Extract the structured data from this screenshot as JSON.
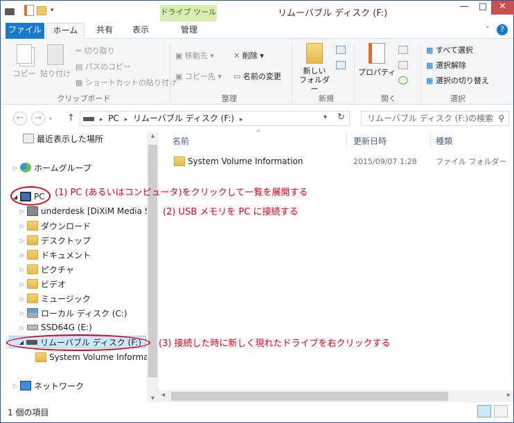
{
  "window": {
    "title": "リムーバブル ディスク (F:)",
    "context_tab": "ドライブ ツール",
    "min_btn": "—",
    "max_btn": "□",
    "close_btn": "✕",
    "help_btn": "?",
    "collapse_btn": "˅"
  },
  "tabs": [
    "ファイル",
    "ホーム",
    "共有",
    "表示",
    "管理"
  ],
  "ribbon": {
    "clipboard": {
      "copy": "コピー",
      "paste": "貼り付け",
      "cut": "切り取り",
      "copy_path": "パスのコピー",
      "paste_shortcut": "ショートカットの貼り付け",
      "group_label": "クリップボード"
    },
    "organize": {
      "move_to": "移動先",
      "copy_to": "コピー先",
      "delete": "削除",
      "rename": "名前の変更",
      "group_label": "整理"
    },
    "new": {
      "new_folder_line1": "新しい",
      "new_folder_line2": "フォルダー",
      "group_label": "新規"
    },
    "open": {
      "properties": "プロパティ",
      "group_label": "開く"
    },
    "select": {
      "select_all": "すべて選択",
      "select_none": "選択解除",
      "invert": "選択の切り替え",
      "group_label": "選択"
    }
  },
  "address": {
    "back": "←",
    "forward": "→",
    "up": "↑",
    "root_sep": "▸",
    "crumb_pc": "PC",
    "crumb_sep": "▸",
    "crumb_drive": "リムーバブル ディスク (F:)",
    "crumb_sep2": "▸",
    "dropdown": "▾",
    "refresh": "↻",
    "search_placeholder": "リムーバブル ディスク (F:)の検索",
    "search_icon": "⚲"
  },
  "nav_tree": [
    {
      "label": "最近表示した場所",
      "expander": ""
    },
    {
      "label": "ホームグループ",
      "expander": "▷"
    },
    {
      "label": "PC",
      "expander": "◢"
    },
    {
      "label": "underdesk [DiXiM Media S",
      "expander": "▷"
    },
    {
      "label": "ダウンロード",
      "expander": "▷"
    },
    {
      "label": "デスクトップ",
      "expander": "▷"
    },
    {
      "label": "ドキュメント",
      "expander": "▷"
    },
    {
      "label": "ピクチャ",
      "expander": "▷"
    },
    {
      "label": "ビデオ",
      "expander": "▷"
    },
    {
      "label": "ミュージック",
      "expander": "▷"
    },
    {
      "label": "ローカル ディスク (C:)",
      "expander": "▷"
    },
    {
      "label": "SSD64G (E:)",
      "expander": "▷"
    },
    {
      "label": "リムーバブル ディスク (F:)",
      "expander": "◢"
    },
    {
      "label": "System Volume Informa",
      "expander": ""
    },
    {
      "label": "ネットワーク",
      "expander": "▷"
    }
  ],
  "columns": {
    "name": "名前",
    "date": "更新日時",
    "type": "種類",
    "sort": "^"
  },
  "files": [
    {
      "name": "System Volume Information",
      "date": "2015/09/07 1:28",
      "type": "ファイル フォルダー"
    }
  ],
  "status": {
    "count": "1 個の項目"
  },
  "annotations": {
    "a1": "(1) PC (あるいはコンピュータ)をクリックして一覧を展開する",
    "a2": "(2) USB メモリを PC に接続する",
    "a3": "(3) 接続した時に新しく現れたドライブを右クリックする"
  },
  "scroll": {
    "up": "▴",
    "down": "▾",
    "left": "◂",
    "right": "▸"
  },
  "colors": {
    "accent": "#1979ca",
    "annotation": "#e1001a",
    "selection": "#cce8ff"
  }
}
